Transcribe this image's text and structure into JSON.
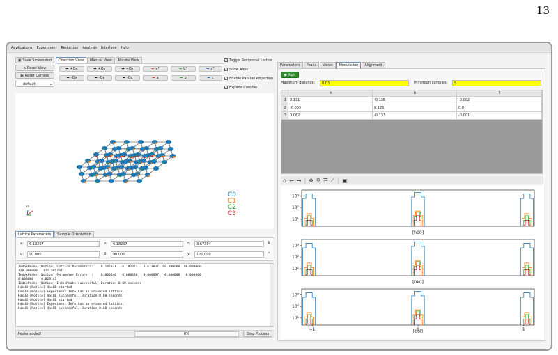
{
  "page": {
    "number": "13"
  },
  "menu": [
    "Applications",
    "Experiment",
    "Reduction",
    "Analysis",
    "Interface",
    "Help"
  ],
  "left": {
    "save_screenshot": "Save Screenshot",
    "reset_view": "Reset View",
    "reset_camera": "Reset Camera",
    "preset": "default",
    "view_tabs": [
      "Direction View",
      "Manual View",
      "Rotate View"
    ],
    "dir_buttons_row1": [
      "+Qx",
      "+Qy",
      "+Qz",
      "a*",
      "b*",
      "c*"
    ],
    "dir_buttons_row2": [
      "-Qx",
      "-Qy",
      "-Qz",
      "a",
      "b",
      "c"
    ],
    "checkboxes": [
      "Toggle Reciprocal Lattice",
      "Show Axes",
      "Enable Parallel Projection",
      "Expand Console"
    ],
    "legend": [
      "C0",
      "C1",
      "C2",
      "C3"
    ],
    "axes_glyph": "ab",
    "lattice_tabs": [
      "Lattice Parameters",
      "Sample Orientation"
    ],
    "lattice": {
      "a_label": "a:",
      "a": "6.18207",
      "b_label": "b:",
      "b": "6.18207",
      "c_label": "c:",
      "c": "3.67384",
      "len_unit": "Å",
      "alpha_label": "α:",
      "alpha": "90.000",
      "beta_label": "β:",
      "beta": "90.000",
      "gamma_label": "γ:",
      "gamma": "120.000",
      "ang_unit": "°"
    },
    "console_lines": [
      "IndexPeaks-[Notice] Lattice Parameters:    6.182071   6.182071   3.673837  90.000000  90.000000",
      "120.000000   121.595787",
      "IndexPeaks-[Notice] Parameter Errors  :    0.000640   0.000640   0.000697   0.000000   0.000000",
      "0.000000    0.029141",
      "IndexPeaks-[Notice] IndexPeaks successful, Duration 0.00 seconds",
      "HasUB-[Notice] HasUB started",
      "HasUB-[Notice] Experiment Info has an oriented lattice.",
      "HasUB-[Notice] HasUB successful, Duration 0.00 seconds",
      "HasUB-[Notice] HasUB started",
      "HasUB-[Notice] Experiment Info has an oriented lattice.",
      "HasUB-[Notice] HasUB successful, Duration 0.00 seconds"
    ],
    "status": "Peaks added!",
    "progress_text": "0%",
    "progress": 0,
    "stop_process": "Stop Process"
  },
  "right": {
    "tabs": [
      "Parameters",
      "Peaks",
      "Views",
      "Modulation",
      "Alignment"
    ],
    "active_tab": "Modulation",
    "run_button": "Run",
    "max_distance_label": "Maximum distance:",
    "max_distance": "0.03",
    "min_samples_label": "Minimum samples:",
    "min_samples": "5",
    "table": {
      "headers": [
        "h",
        "k",
        "l"
      ],
      "rows": [
        [
          "1",
          "0.131",
          "-0.135",
          "-0.002"
        ],
        [
          "2",
          "-0.003",
          "0.125",
          "0.0"
        ],
        [
          "3",
          "0.062",
          "-0.133",
          "-0.001"
        ]
      ]
    },
    "toolbar_icons": [
      "home-icon",
      "back-icon",
      "forward-icon",
      "pan-icon",
      "zoom-icon",
      "configure-icon",
      "edit-axis-icon",
      "save-icon"
    ]
  },
  "colors": {
    "C0": "#1f77b4",
    "C1": "#ff7f0e",
    "C2": "#2ca02c",
    "C3": "#d62728",
    "highlight": "#ffff00",
    "run": "#2e8b2e"
  },
  "chart_data": [
    {
      "type": "line",
      "xlabel": "[h00]",
      "yscale": "log",
      "yticks": [
        "10¹",
        "10²",
        "10³"
      ]
    },
    {
      "type": "line",
      "xlabel": "[0k0]",
      "yscale": "log",
      "yticks": [
        "10¹",
        "10²",
        "10³"
      ]
    },
    {
      "type": "line",
      "xlabel": "[00l]",
      "yscale": "log",
      "yticks": [
        "10¹",
        "10²",
        "10³"
      ],
      "xticks": [
        "−1",
        "0",
        "1"
      ]
    }
  ]
}
